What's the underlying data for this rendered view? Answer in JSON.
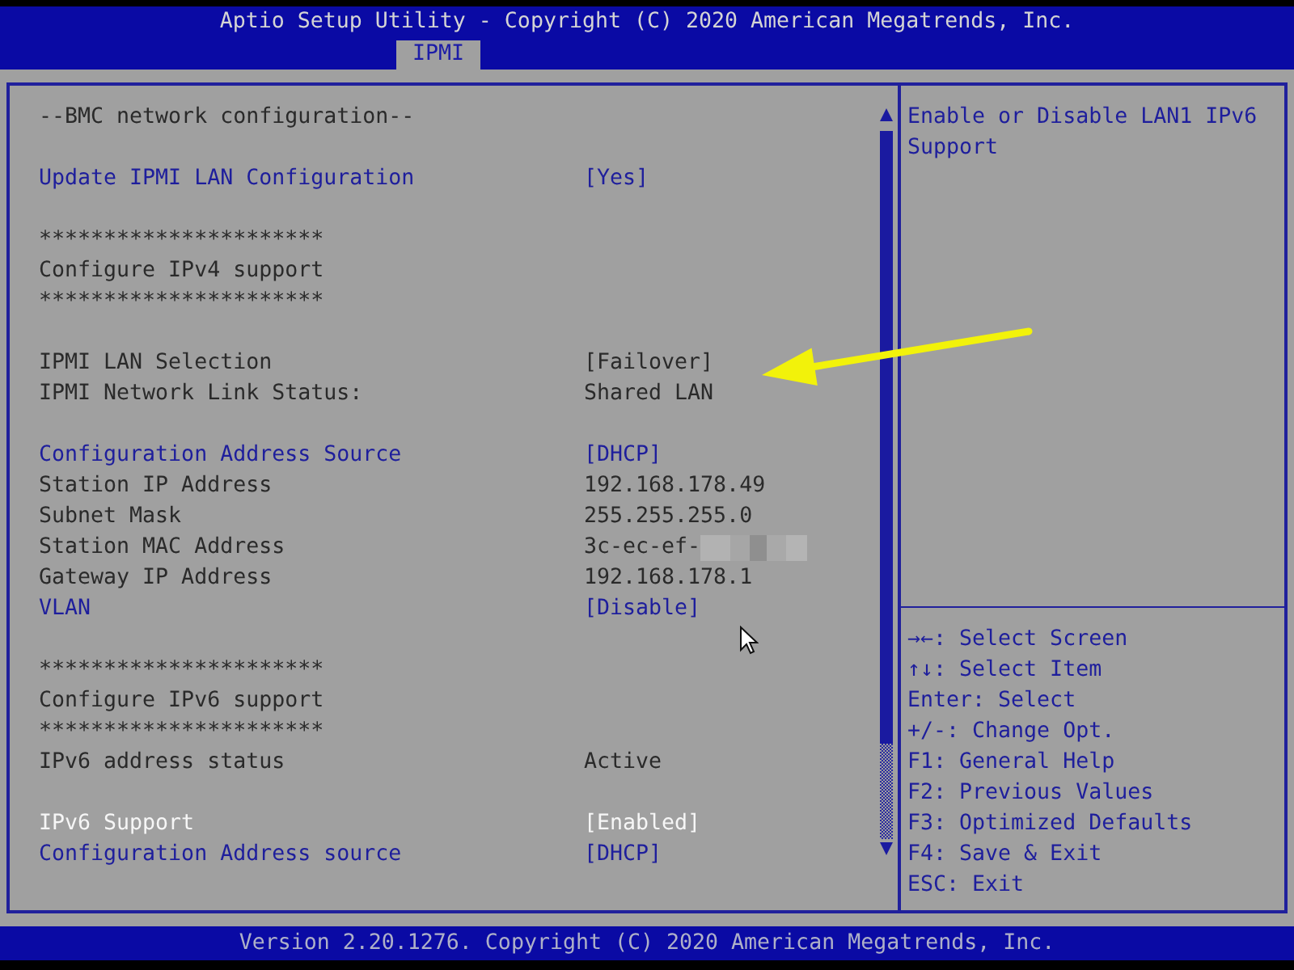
{
  "title_bar": {
    "title": "Aptio Setup Utility - Copyright (C) 2020 American Megatrends, Inc.",
    "tabs": [
      {
        "label": "IPMI",
        "selected": true
      }
    ]
  },
  "settings": {
    "sections": [
      {
        "rows": [
          {
            "kind": "title",
            "text": "--BMC network configuration--"
          }
        ]
      },
      {
        "rows": [
          {
            "kind": "option",
            "label": "Update IPMI LAN Configuration",
            "value": "[Yes]",
            "selected": false
          }
        ]
      },
      {
        "rows": [
          {
            "kind": "rule",
            "text": "**********************"
          },
          {
            "kind": "heading",
            "text": "Configure IPv4 support"
          },
          {
            "kind": "rule",
            "text": "**********************"
          }
        ]
      },
      {
        "rows": [
          {
            "kind": "info",
            "label": "IPMI LAN Selection",
            "value": "[Failover]"
          },
          {
            "kind": "info",
            "label": "IPMI Network Link Status:",
            "value": "Shared LAN"
          }
        ]
      },
      {
        "rows": [
          {
            "kind": "option",
            "label": "Configuration Address Source",
            "value": "[DHCP]",
            "selected": false
          },
          {
            "kind": "info",
            "label": "Station IP Address",
            "value": "192.168.178.49"
          },
          {
            "kind": "info",
            "label": "Subnet Mask",
            "value": "255.255.255.0"
          },
          {
            "kind": "info",
            "label": "Station MAC Address",
            "value": "3c-ec-ef-",
            "redacted": true
          },
          {
            "kind": "info",
            "label": "Gateway IP Address",
            "value": "192.168.178.1"
          },
          {
            "kind": "option",
            "label": "VLAN",
            "value": "[Disable]",
            "selected": false
          }
        ]
      },
      {
        "rows": [
          {
            "kind": "rule",
            "text": "**********************"
          },
          {
            "kind": "heading",
            "text": "Configure IPv6 support"
          },
          {
            "kind": "rule",
            "text": "**********************"
          },
          {
            "kind": "info",
            "label": "IPv6 address status",
            "value": "Active"
          }
        ]
      },
      {
        "rows": [
          {
            "kind": "option",
            "label": "IPv6 Support",
            "value": "[Enabled]",
            "selected": true
          },
          {
            "kind": "option",
            "label": "Configuration Address source",
            "value": "[DHCP]",
            "selected": false
          }
        ]
      }
    ]
  },
  "help": {
    "text": "Enable or Disable LAN1 IPv6 Support",
    "keys": [
      "→←: Select Screen",
      "↑↓: Select Item",
      "Enter: Select",
      "+/-: Change Opt.",
      "F1: General Help",
      "F2: Previous Values",
      "F3: Optimized Defaults",
      "F4: Save & Exit",
      "ESC: Exit"
    ]
  },
  "status_bar": {
    "text": "Version 2.20.1276. Copyright (C) 2020 American Megatrends, Inc."
  }
}
